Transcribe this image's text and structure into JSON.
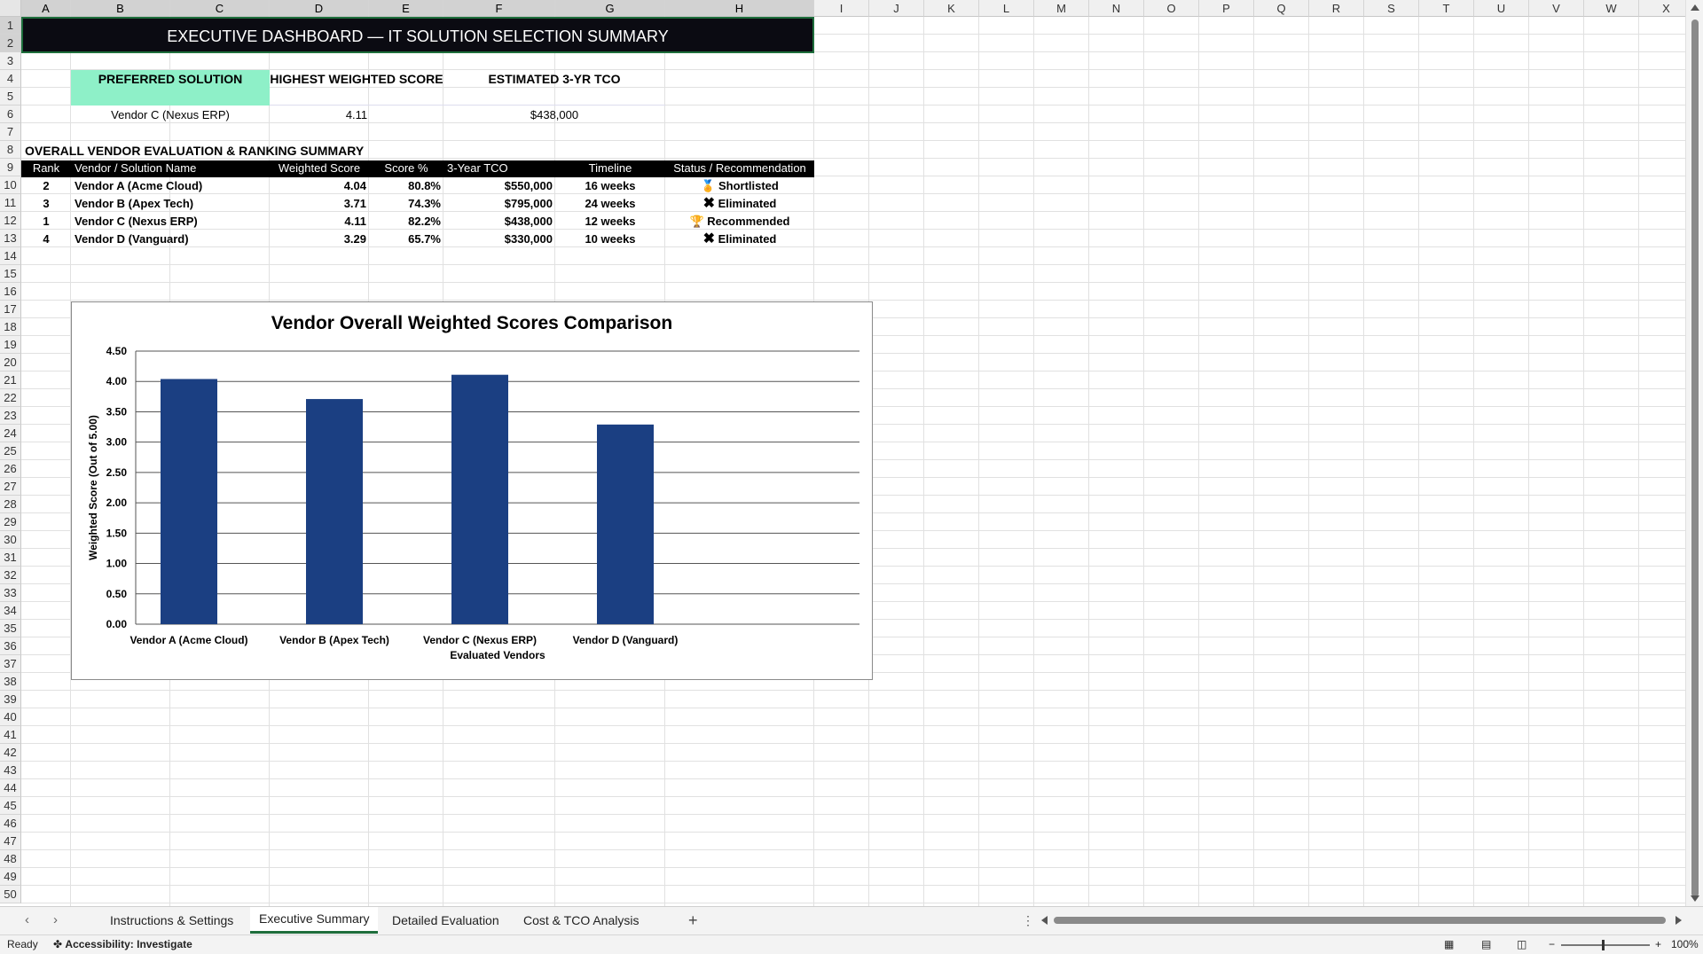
{
  "columns": [
    "A",
    "B",
    "C",
    "D",
    "E",
    "F",
    "G",
    "H",
    "I",
    "J",
    "K",
    "L",
    "M",
    "N",
    "O",
    "P",
    "Q",
    "R",
    "S",
    "T",
    "U",
    "V",
    "W",
    "X"
  ],
  "rows": [
    "1",
    "2",
    "3",
    "4",
    "5",
    "6",
    "7",
    "8",
    "9",
    "10",
    "11",
    "12",
    "13",
    "14",
    "15",
    "16",
    "17",
    "18",
    "19",
    "20",
    "21",
    "22",
    "23",
    "24",
    "25",
    "26",
    "27",
    "28",
    "29",
    "30",
    "31",
    "32",
    "33",
    "34",
    "35",
    "36",
    "37",
    "38",
    "39",
    "40",
    "41",
    "42",
    "43",
    "44",
    "45",
    "46",
    "47",
    "48",
    "49",
    "50"
  ],
  "dashboard": {
    "title": "EXECUTIVE DASHBOARD — IT SOLUTION SELECTION SUMMARY",
    "kpis": [
      {
        "label": "PREFERRED SOLUTION",
        "value": "Vendor C (Nexus ERP)",
        "color": "#8ef0c8"
      },
      {
        "label": "HIGHEST WEIGHTED SCORE",
        "value": "4.11"
      },
      {
        "label": "ESTIMATED 3-YR TCO",
        "value": "$438,000"
      }
    ],
    "section_title": "OVERALL VENDOR EVALUATION & RANKING SUMMARY",
    "table_headers": [
      "Rank",
      "Vendor / Solution Name",
      "Weighted Score",
      "Score %",
      "3-Year TCO",
      "Timeline",
      "Status / Recommendation"
    ],
    "table_rows": [
      {
        "rank": "2",
        "vendor": "Vendor A (Acme Cloud)",
        "score": "4.04",
        "pct": "80.8%",
        "tco": "$550,000",
        "timeline": "16 weeks",
        "status": "Shortlisted",
        "icon": "medal-icon"
      },
      {
        "rank": "3",
        "vendor": "Vendor B (Apex Tech)",
        "score": "3.71",
        "pct": "74.3%",
        "tco": "$795,000",
        "timeline": "24 weeks",
        "status": "Eliminated",
        "icon": "cross-icon"
      },
      {
        "rank": "1",
        "vendor": "Vendor C (Nexus ERP)",
        "score": "4.11",
        "pct": "82.2%",
        "tco": "$438,000",
        "timeline": "12 weeks",
        "status": "Recommended",
        "icon": "trophy-icon"
      },
      {
        "rank": "4",
        "vendor": "Vendor D (Vanguard)",
        "score": "3.29",
        "pct": "65.7%",
        "tco": "$330,000",
        "timeline": "10 weeks",
        "status": "Eliminated",
        "icon": "cross-icon"
      }
    ]
  },
  "chart_data": {
    "type": "bar",
    "title": "Vendor Overall Weighted Scores Comparison",
    "categories": [
      "Vendor A (Acme Cloud)",
      "Vendor B (Apex Tech)",
      "Vendor C (Nexus ERP)",
      "Vendor D (Vanguard)"
    ],
    "values": [
      4.04,
      3.71,
      4.11,
      3.29
    ],
    "xlabel": "Evaluated Vendors",
    "ylabel": "Weighted Score (Out of 5.00)",
    "ylim": [
      0,
      4.5
    ],
    "yticks": [
      "0.00",
      "0.50",
      "1.00",
      "1.50",
      "2.00",
      "2.50",
      "3.00",
      "3.50",
      "4.00",
      "4.50"
    ],
    "grid": true,
    "bar_color": "#1b3f82"
  },
  "tabs": [
    "Instructions & Settings",
    "Executive Summary",
    "Detailed Evaluation",
    "Cost & TCO Analysis"
  ],
  "status": {
    "ready": "Ready",
    "accessibility": "Accessibility: Investigate",
    "zoom": "100%"
  }
}
